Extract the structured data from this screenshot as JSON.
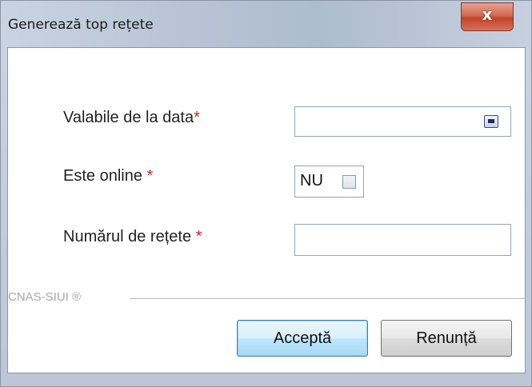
{
  "window": {
    "title": "Generează top rețete",
    "close_label": "x"
  },
  "form": {
    "valid_from": {
      "label": "Valabile de la data",
      "required_mark": "*",
      "value": ""
    },
    "online": {
      "label": "Este online ",
      "required_mark": "*",
      "value_text": "NU",
      "checked": false
    },
    "count": {
      "label": "Numărul de rețete ",
      "required_mark": "*",
      "value": ""
    }
  },
  "footer": {
    "brand": "CNAS-SIUI ®"
  },
  "buttons": {
    "accept": "Acceptă",
    "cancel": "Renunță"
  },
  "colors": {
    "required": "#d32020",
    "default_button_border": "#3c7fb1",
    "close_button": "#c1442a"
  },
  "icons": {
    "calendar": "calendar-icon",
    "close": "close-icon"
  }
}
